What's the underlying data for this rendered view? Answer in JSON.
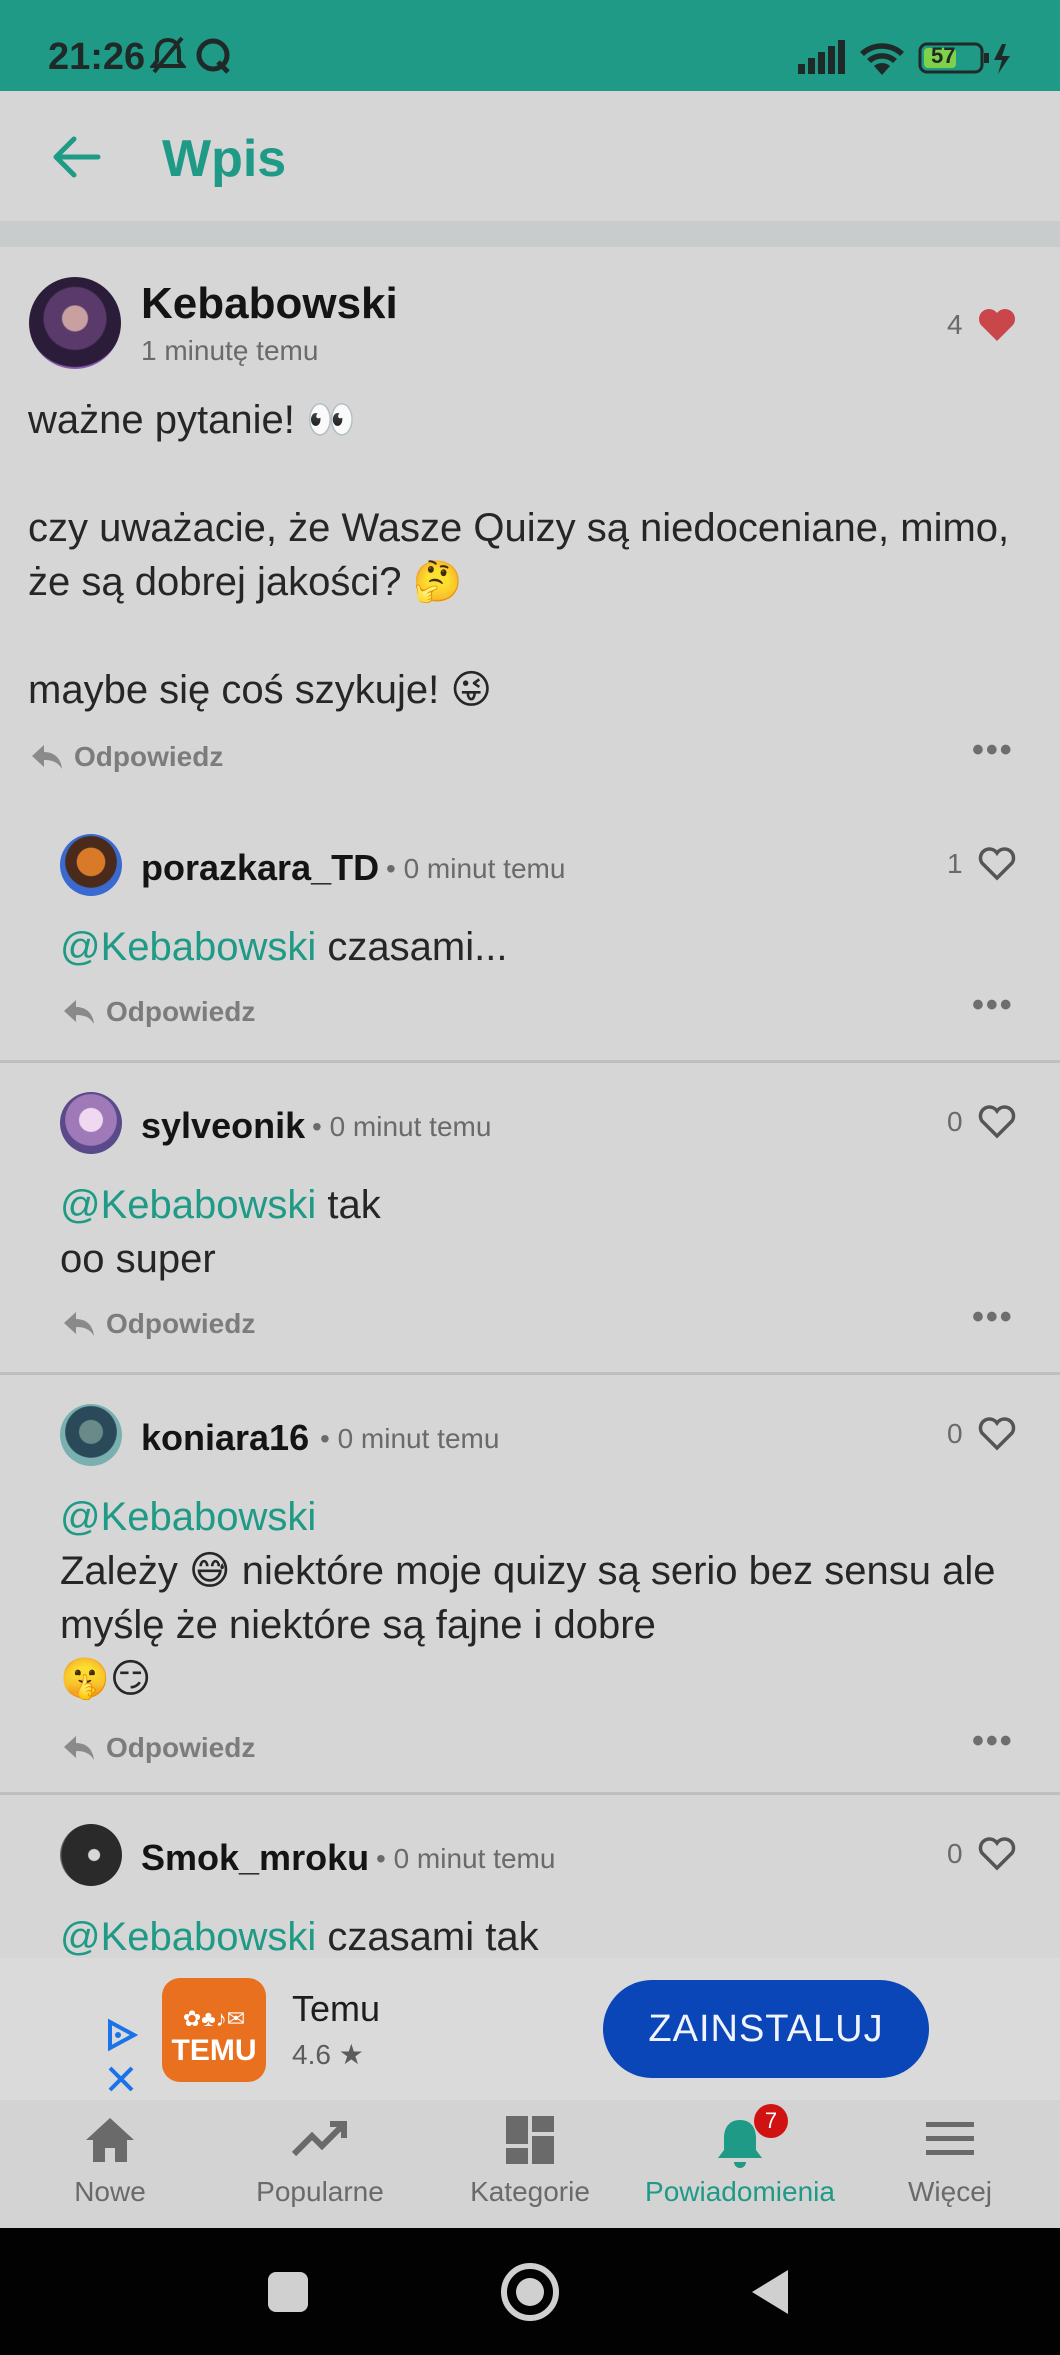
{
  "status_bar": {
    "time": "21:26",
    "battery": "57"
  },
  "app_bar": {
    "title": "Wpis"
  },
  "post": {
    "author": "Kebabowski",
    "time": "1 minutę temu",
    "likes": "4",
    "body": "ważne pytanie! 👀\n\nczy uważacie, że Wasze Quizy są niedoceniane, mimo, że są dobrej jakości? 🤔\n\nmaybe się coś szykuje! 😜",
    "reply_label": "Odpowiedz"
  },
  "comments": [
    {
      "author": "porazkara_TD",
      "time": "• 0 minut temu",
      "likes": "1",
      "mention": "@Kebabowski",
      "text": " czasami...",
      "reply_label": "Odpowiedz"
    },
    {
      "author": "sylveonik",
      "time": "• 0 minut temu",
      "likes": "0",
      "mention": "@Kebabowski",
      "text": " tak\noo super",
      "reply_label": "Odpowiedz"
    },
    {
      "author": "koniara16",
      "time": "• 0 minut temu",
      "likes": "0",
      "mention": "@Kebabowski",
      "text": "\nZależy 😅 niektóre moje quizy są serio bez sensu ale myślę że niektóre są fajne i dobre\n🤫😏",
      "reply_label": "Odpowiedz"
    },
    {
      "author": "Smok_mroku",
      "time": "• 0 minut temu",
      "likes": "0",
      "mention": "@Kebabowski",
      "text": " czasami tak"
    }
  ],
  "ad": {
    "app_name": "Temu",
    "rating": "4.6 ★",
    "install_label": "ZAINSTALUJ",
    "logo_text": "TEMU"
  },
  "nav": {
    "items": [
      {
        "label": "Nowe",
        "icon": "home-icon"
      },
      {
        "label": "Popularne",
        "icon": "trending-icon"
      },
      {
        "label": "Kategorie",
        "icon": "dashboard-icon"
      },
      {
        "label": "Powiadomienia",
        "icon": "bell-icon",
        "badge": "7"
      },
      {
        "label": "Więcej",
        "icon": "menu-icon"
      }
    ]
  },
  "colors": {
    "accent": "#1e9a86",
    "heart": "#c9474a",
    "install": "#0b46b8"
  }
}
